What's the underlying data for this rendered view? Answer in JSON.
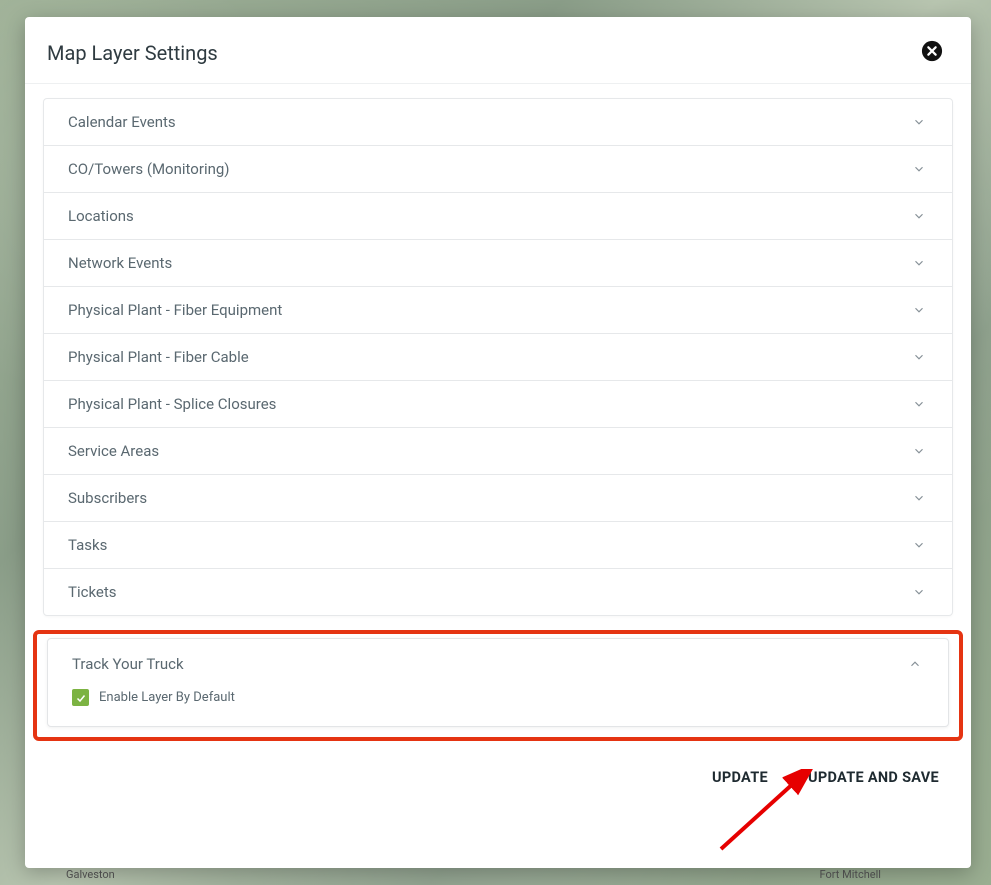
{
  "dialog": {
    "title": "Map Layer Settings"
  },
  "layers": [
    {
      "label": "Calendar Events"
    },
    {
      "label": "CO/Towers (Monitoring)"
    },
    {
      "label": "Locations"
    },
    {
      "label": "Network Events"
    },
    {
      "label": "Physical Plant - Fiber Equipment"
    },
    {
      "label": "Physical Plant - Fiber Cable"
    },
    {
      "label": "Physical Plant - Splice Closures"
    },
    {
      "label": "Service Areas"
    },
    {
      "label": "Subscribers"
    },
    {
      "label": "Tasks"
    },
    {
      "label": "Tickets"
    }
  ],
  "expanded_layer": {
    "label": "Track Your Truck",
    "checkbox_label": "Enable Layer By Default",
    "checked": true
  },
  "footer": {
    "update": "UPDATE",
    "update_and_save": "UPDATE AND SAVE"
  },
  "map_labels": {
    "galveston": "Galveston",
    "fort_mitchell": "Fort Mitchell"
  }
}
